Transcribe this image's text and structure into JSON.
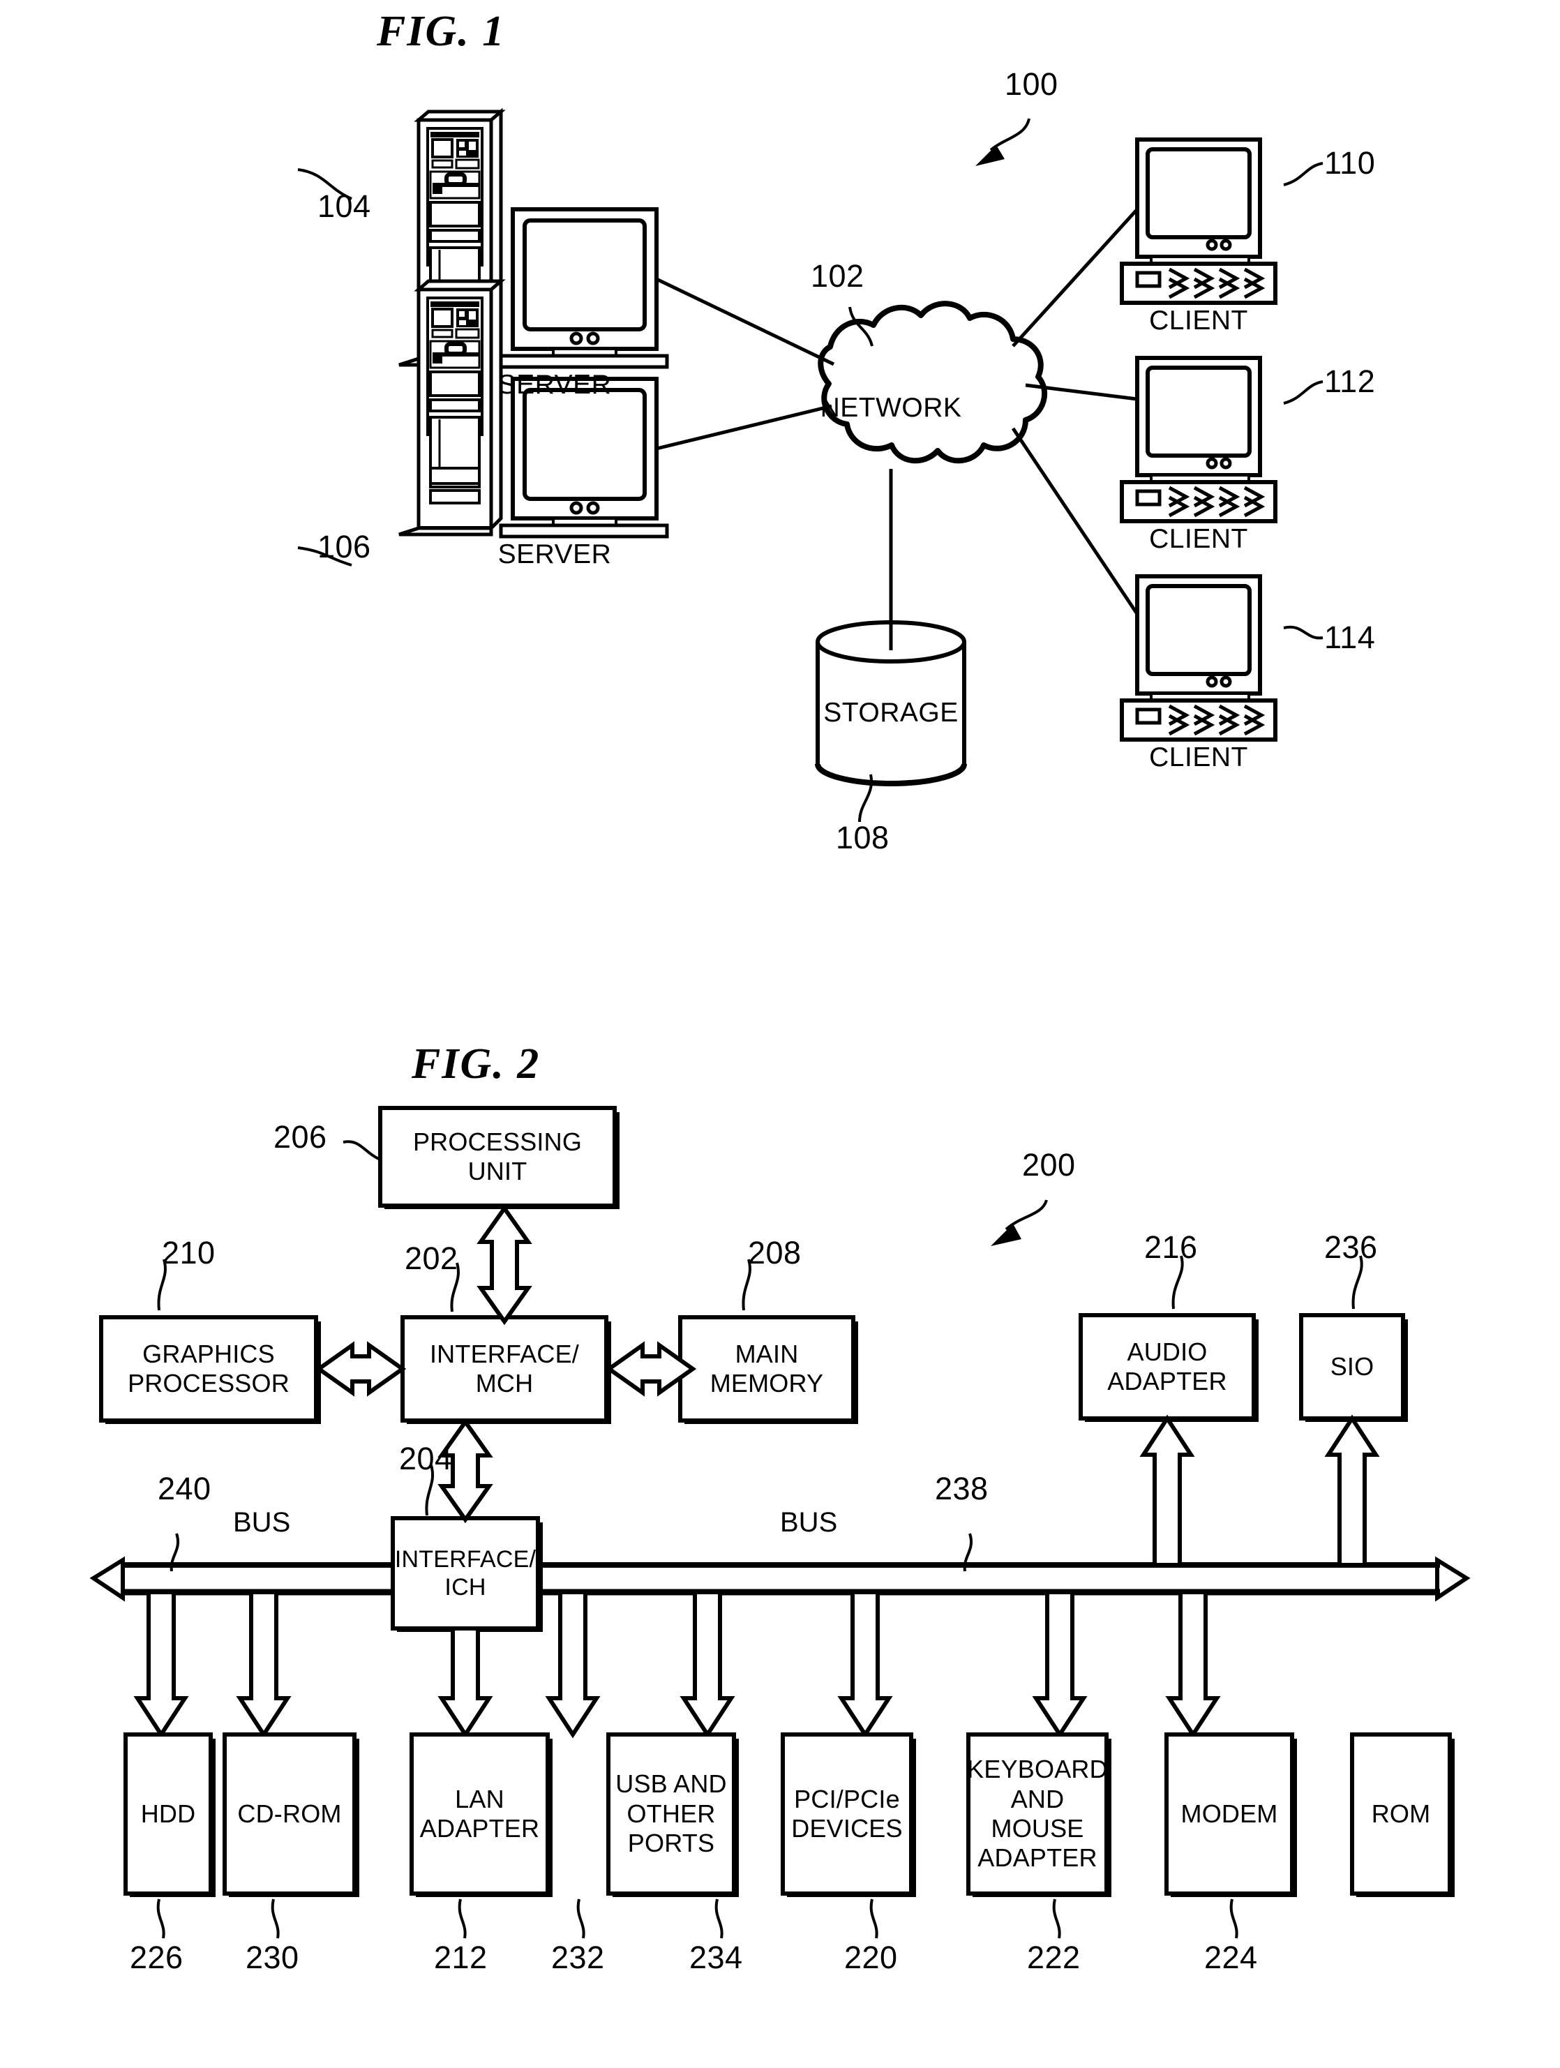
{
  "document": {
    "type": "patent-drawing-sheet",
    "figures": [
      "FIG. 1",
      "FIG. 2"
    ]
  },
  "fig1": {
    "title": "FIG. 1",
    "system_ref": "100",
    "nodes": {
      "server_top": {
        "label": "SERVER",
        "ref": "104"
      },
      "server_bottom": {
        "label": "SERVER",
        "ref": "106"
      },
      "network": {
        "label": "NETWORK",
        "ref": "102"
      },
      "storage": {
        "label": "STORAGE",
        "ref": "108"
      },
      "client_1": {
        "label": "CLIENT",
        "ref": "110"
      },
      "client_2": {
        "label": "CLIENT",
        "ref": "112"
      },
      "client_3": {
        "label": "CLIENT",
        "ref": "114"
      }
    }
  },
  "fig2": {
    "title": "FIG. 2",
    "system_ref": "200",
    "bus_labels": {
      "left": "BUS",
      "right": "BUS"
    },
    "bus_refs": {
      "left": "240",
      "right": "238"
    },
    "boxes": {
      "processing_unit": {
        "label": "PROCESSING UNIT",
        "lines": [
          "PROCESSING",
          "UNIT"
        ],
        "ref": "206"
      },
      "interface_mch": {
        "label": "INTERFACE/ MCH",
        "lines": [
          "INTERFACE/",
          "MCH"
        ],
        "ref": "202"
      },
      "interface_ich": {
        "label": "INTERFACE/ ICH",
        "lines": [
          "INTERFACE/",
          "ICH"
        ],
        "ref": "204"
      },
      "graphics_processor": {
        "label": "GRAPHICS PROCESSOR",
        "lines": [
          "GRAPHICS",
          "PROCESSOR"
        ],
        "ref": "210"
      },
      "main_memory": {
        "label": "MAIN MEMORY",
        "lines": [
          "MAIN",
          "MEMORY"
        ],
        "ref": "208"
      },
      "audio_adapter": {
        "label": "AUDIO ADAPTER",
        "lines": [
          "AUDIO",
          "ADAPTER"
        ],
        "ref": "216"
      },
      "sio": {
        "label": "SIO",
        "lines": [
          "SIO"
        ],
        "ref": "236"
      },
      "hdd": {
        "label": "HDD",
        "lines": [
          "HDD"
        ],
        "ref": "226"
      },
      "cdrom": {
        "label": "CD-ROM",
        "lines": [
          "CD-ROM"
        ],
        "ref": "230"
      },
      "lan_adapter": {
        "label": "LAN ADAPTER",
        "lines": [
          "LAN",
          "ADAPTER"
        ],
        "ref": "212"
      },
      "usb_ports": {
        "label": "USB AND OTHER PORTS",
        "lines": [
          "USB AND",
          "OTHER",
          "PORTS"
        ],
        "ref": "232"
      },
      "pci_devices": {
        "label": "PCI/PCIe DEVICES",
        "lines": [
          "PCI/PCIe",
          "DEVICES"
        ],
        "ref": "234"
      },
      "keyboard_mouse": {
        "label": "KEYBOARD AND MOUSE ADAPTER",
        "lines": [
          "KEYBOARD",
          "AND",
          "MOUSE",
          "ADAPTER"
        ],
        "ref": "220"
      },
      "modem": {
        "label": "MODEM",
        "lines": [
          "MODEM"
        ],
        "ref": "222"
      },
      "rom": {
        "label": "ROM",
        "lines": [
          "ROM"
        ],
        "ref": "224"
      }
    }
  },
  "colors": {
    "ink": "#000000",
    "paper": "#ffffff"
  }
}
